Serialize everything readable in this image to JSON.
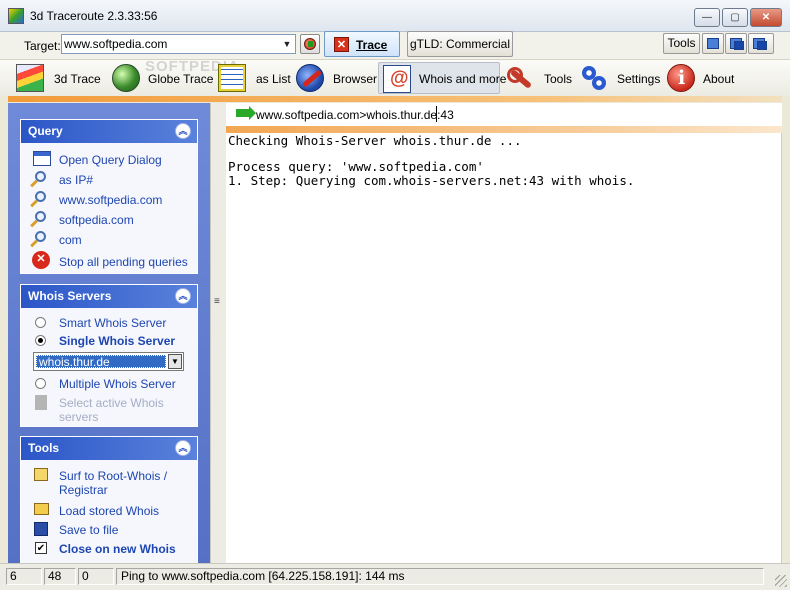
{
  "window": {
    "title": "3d Traceroute 2.3.33:56",
    "controls": {
      "minimize": "—",
      "maximize": "▢",
      "close": "✕"
    }
  },
  "target_bar": {
    "label": "Target:",
    "value": "www.softpedia.com",
    "trace_button": "Trace",
    "gtld_button": "gTLD: Commercial",
    "tools_button": "Tools"
  },
  "toolbar": {
    "items": [
      {
        "label": "3d Trace",
        "icon": "3d-trace-icon"
      },
      {
        "label": "Globe Trace",
        "icon": "globe-icon"
      },
      {
        "label": "as List",
        "icon": "list-icon"
      },
      {
        "label": "Browser",
        "icon": "browser-icon"
      },
      {
        "label": "Whois and more",
        "icon": "whois-at-icon",
        "active": true
      },
      {
        "label": "Tools",
        "icon": "wrench-icon"
      },
      {
        "label": "Settings",
        "icon": "gears-icon"
      },
      {
        "label": "About",
        "icon": "info-icon"
      }
    ]
  },
  "sidebar": {
    "query": {
      "title": "Query",
      "items": [
        {
          "label": "Open Query Dialog",
          "icon": "window-icon"
        },
        {
          "label": "as IP#",
          "icon": "magnifier-icon"
        },
        {
          "label": "www.softpedia.com",
          "icon": "magnifier-icon"
        },
        {
          "label": "softpedia.com",
          "icon": "magnifier-icon"
        },
        {
          "label": "com",
          "icon": "magnifier-icon"
        },
        {
          "label": "Stop all pending queries",
          "icon": "stop-icon"
        }
      ]
    },
    "whois_servers": {
      "title": "Whois Servers",
      "smart": "Smart Whois Server",
      "single": "Single Whois Server",
      "single_selected": true,
      "server_value": "whois.thur.de",
      "multiple": "Multiple Whois Server",
      "select_active": "Select active Whois servers"
    },
    "tools": {
      "title": "Tools",
      "items": [
        {
          "label": "Surf to Root-Whois / Registrar",
          "icon": "house-icon"
        },
        {
          "label": "Load stored Whois",
          "icon": "folder-icon"
        },
        {
          "label": "Save to file",
          "icon": "disk-icon"
        },
        {
          "label": "Close on new Whois",
          "icon": "checkbox-icon",
          "checked": true
        }
      ]
    }
  },
  "address": {
    "text": "www.softpedia.com>whois.thur.de:43"
  },
  "output": {
    "lines": [
      "Checking Whois-Server whois.thur.de ...",
      "",
      "Process query: 'www.softpedia.com'",
      "1. Step: Querying com.whois-servers.net:43 with whois."
    ]
  },
  "status": {
    "cell1": "6",
    "cell2": "48",
    "cell3": "0",
    "message": "Ping to www.softpedia.com [64.225.158.191]: 144 ms"
  },
  "watermark": "SOFTPEDIA"
}
